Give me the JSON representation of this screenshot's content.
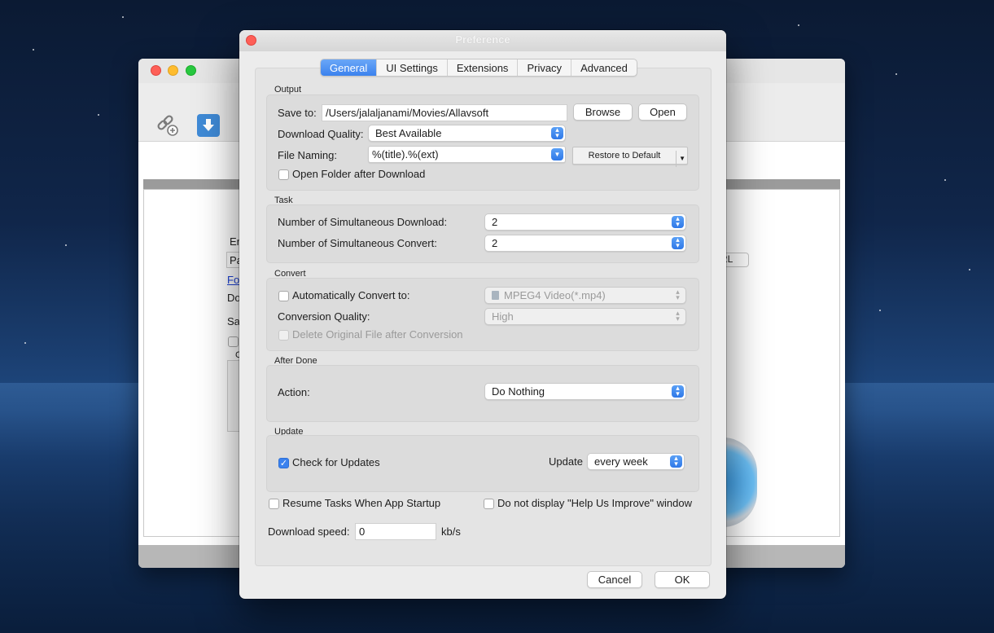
{
  "dialog": {
    "title": "Preference",
    "tabs": [
      {
        "label": "General",
        "active": true
      },
      {
        "label": "UI Settings",
        "active": false
      },
      {
        "label": "Extensions",
        "active": false
      },
      {
        "label": "Privacy",
        "active": false
      },
      {
        "label": "Advanced",
        "active": false
      }
    ],
    "output": {
      "section": "Output",
      "save_to_label": "Save to:",
      "save_to_value": "/Users/jalaljanami/Movies/Allavsoft",
      "browse": "Browse",
      "open": "Open",
      "quality_label": "Download Quality:",
      "quality_value": "Best Available",
      "naming_label": "File Naming:",
      "naming_value": "%(title).%(ext)",
      "restore_default": "Restore to Default",
      "open_folder_label": "Open Folder after Download",
      "open_folder_checked": false
    },
    "task": {
      "section": "Task",
      "sim_download_label": "Number of Simultaneous Download:",
      "sim_download_value": "2",
      "sim_convert_label": "Number of Simultaneous Convert:",
      "sim_convert_value": "2"
    },
    "convert": {
      "section": "Convert",
      "auto_convert_label": "Automatically Convert to:",
      "auto_convert_checked": false,
      "format_value": "MPEG4 Video(*.mp4)",
      "quality_label": "Conversion Quality:",
      "quality_value": "High",
      "delete_original_label": "Delete Original File after Conversion"
    },
    "after_done": {
      "section": "After Done",
      "action_label": "Action:",
      "action_value": "Do Nothing"
    },
    "update": {
      "section": "Update",
      "check_label": "Check for Updates",
      "check_checked": true,
      "update_label": "Update",
      "update_value": "every week"
    },
    "resume_label": "Resume Tasks When App Startup",
    "help_improve_label": "Do not display \"Help Us Improve\" window",
    "speed_label": "Download speed:",
    "speed_value": "0",
    "speed_unit": "kb/s",
    "cancel": "Cancel",
    "ok": "OK"
  },
  "background_window": {
    "fragments": [
      "Er",
      "Pa",
      "Fo",
      "Do",
      "Sa",
      "C",
      "RL"
    ]
  },
  "colors": {
    "accent": "#3b82ee",
    "close_red": "#fe5f57"
  }
}
